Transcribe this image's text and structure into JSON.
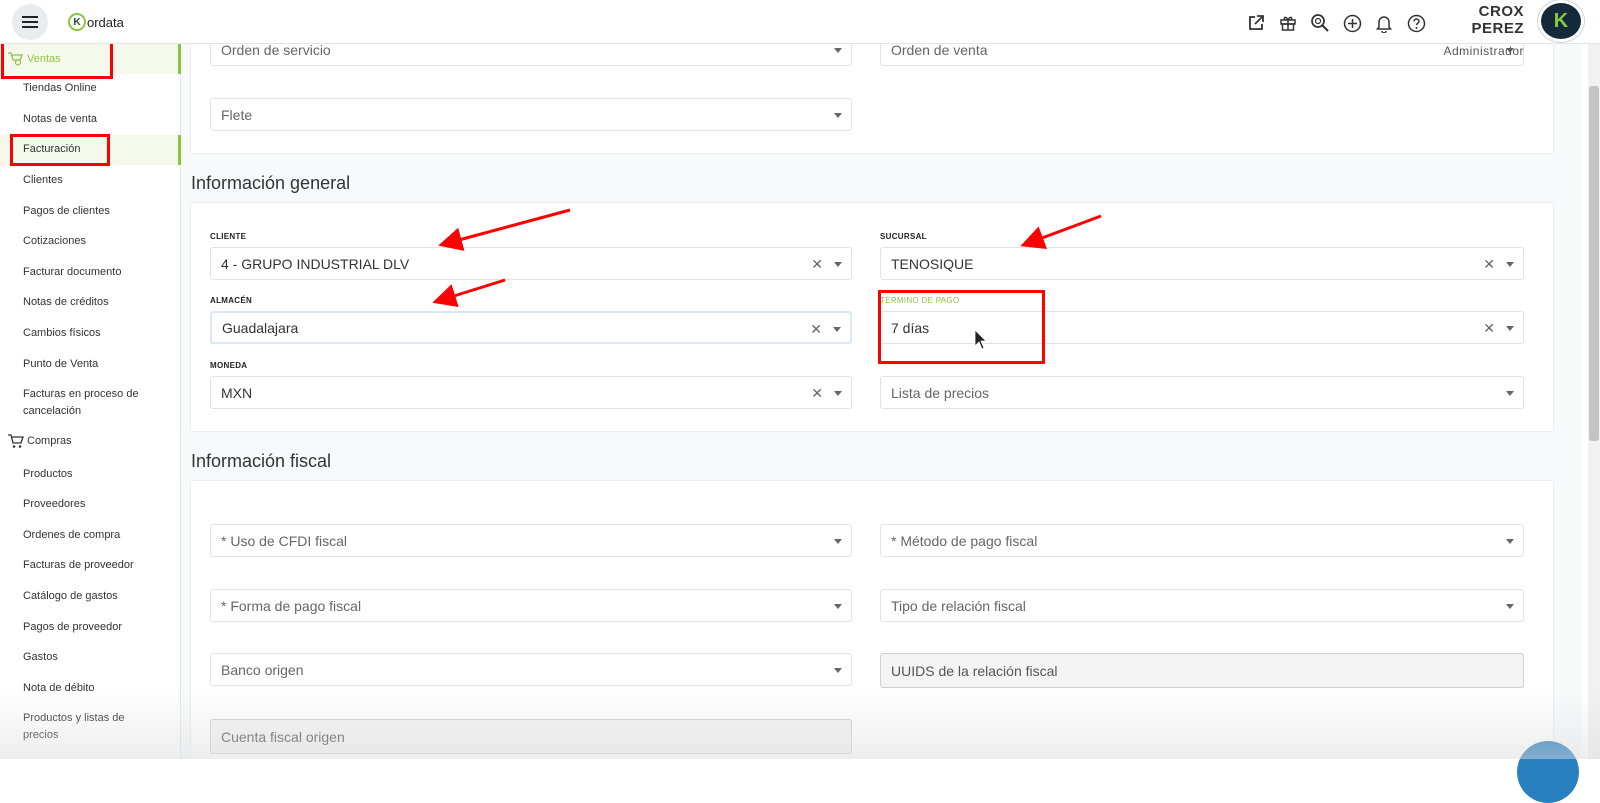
{
  "app": {
    "logo_text": "ordata",
    "logo_letter": "K"
  },
  "topbar": {
    "icons": [
      "external-link-icon",
      "gift-icon",
      "search-zoom-icon",
      "plus-circle-icon",
      "bell-icon",
      "help-icon"
    ],
    "user_name": "CROX PEREZ",
    "user_role": "Administrador",
    "avatar_letter": "K"
  },
  "sidebar": {
    "ventas_label": "Ventas",
    "ventas_items": [
      "Tiendas Online",
      "Notas de venta",
      "Facturación",
      "Clientes",
      "Pagos de clientes",
      "Cotizaciones",
      "Facturar documento",
      "Notas de créditos",
      "Cambios físicos",
      "Punto de Venta",
      "Facturas en proceso de cancelación"
    ],
    "compras_label": "Compras",
    "compras_items": [
      "Productos",
      "Proveedores",
      "Ordenes de compra",
      "Facturas de proveedor",
      "Catálogo de gastos",
      "Pagos de proveedor",
      "Gastos",
      "Nota de débito",
      "Productos y listas de precios"
    ],
    "active_item": "Facturación"
  },
  "top_section": {
    "orden_servicio": "Orden de servicio",
    "orden_venta": "Orden de venta",
    "flete": "Flete"
  },
  "info_general": {
    "title": "Información general",
    "cliente_label": "CLIENTE",
    "cliente_value": "4 - GRUPO INDUSTRIAL DLV",
    "sucursal_label": "SUCURSAL",
    "sucursal_value": "TENOSIQUE",
    "almacen_label": "ALMACÉN",
    "almacen_value": "Guadalajara",
    "termino_label": "TÉRMINO DE PAGO",
    "termino_value": "7 días",
    "moneda_label": "MONEDA",
    "moneda_value": "MXN",
    "lista_precios": "Lista de precios"
  },
  "info_fiscal": {
    "title": "Información fiscal",
    "uso_cfdi": "* Uso de CFDI fiscal",
    "metodo_pago": "* Método de pago fiscal",
    "forma_pago": "* Forma de pago fiscal",
    "tipo_relacion": "Tipo de relación fiscal",
    "banco_origen": "Banco origen",
    "uuids": "UUIDS de la relación fiscal",
    "cuenta_origen": "Cuenta fiscal origen"
  },
  "colors": {
    "accent": "#8cc63f",
    "annotation": "#ff0000",
    "brand_dark": "#142a3a"
  }
}
